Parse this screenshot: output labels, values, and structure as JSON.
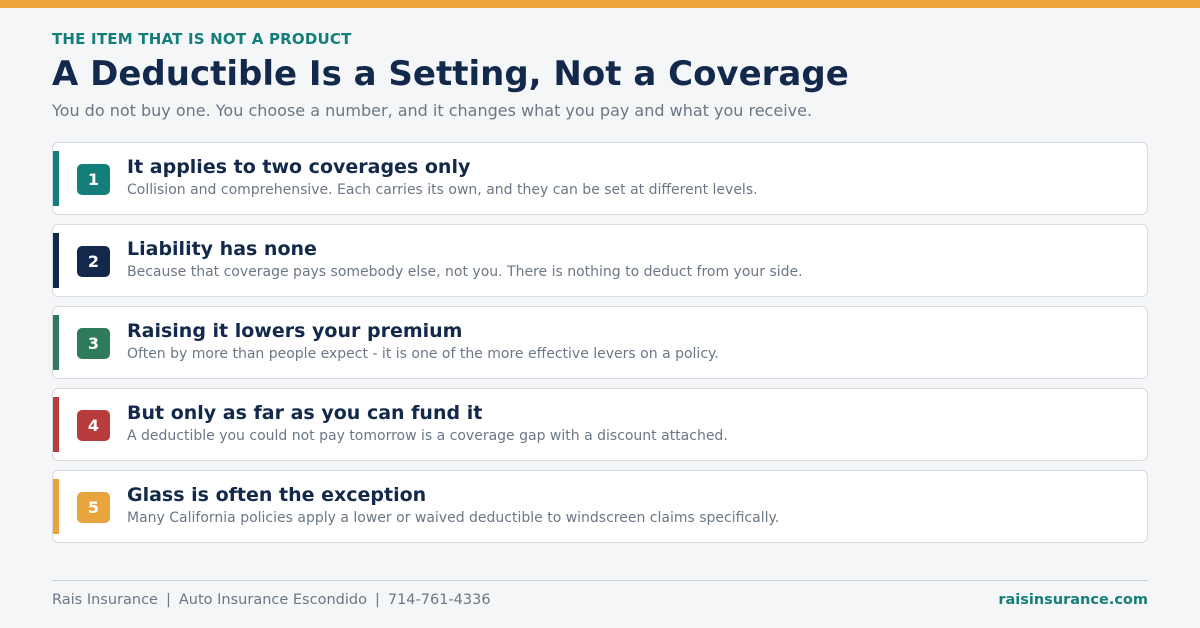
{
  "colors": {
    "accent_orange": "#eba53c",
    "teal": "#137e7a",
    "navy": "#13294b",
    "green": "#2e7a59",
    "red": "#b83c3c",
    "gold": "#e8a53d"
  },
  "header": {
    "eyebrow": "THE ITEM THAT IS NOT A PRODUCT",
    "title": "A Deductible Is a Setting, Not a Coverage",
    "subtitle": "You do not buy one. You choose a number, and it changes what you pay and what you receive."
  },
  "cards": [
    {
      "number": "1",
      "title": "It applies to two coverages only",
      "description": "Collision and comprehensive. Each carries its own, and they can be set at different levels.",
      "color": "#137e7a"
    },
    {
      "number": "2",
      "title": "Liability has none",
      "description": "Because that coverage pays somebody else, not you. There is nothing to deduct from your side.",
      "color": "#13294b"
    },
    {
      "number": "3",
      "title": "Raising it lowers your premium",
      "description": "Often by more than people expect - it is one of the more effective levers on a policy.",
      "color": "#2e7a59"
    },
    {
      "number": "4",
      "title": "But only as far as you can fund it",
      "description": "A deductible you could not pay tomorrow is a coverage gap with a discount attached.",
      "color": "#b83c3c"
    },
    {
      "number": "5",
      "title": "Glass is often the exception",
      "description": "Many California policies apply a lower or waived deductible to windscreen claims specifically.",
      "color": "#e8a53d"
    }
  ],
  "footer": {
    "brand": "Rais Insurance",
    "service": "Auto Insurance Escondido",
    "phone": "714-761-4336",
    "separator": "|",
    "website": "raisinsurance.com"
  }
}
